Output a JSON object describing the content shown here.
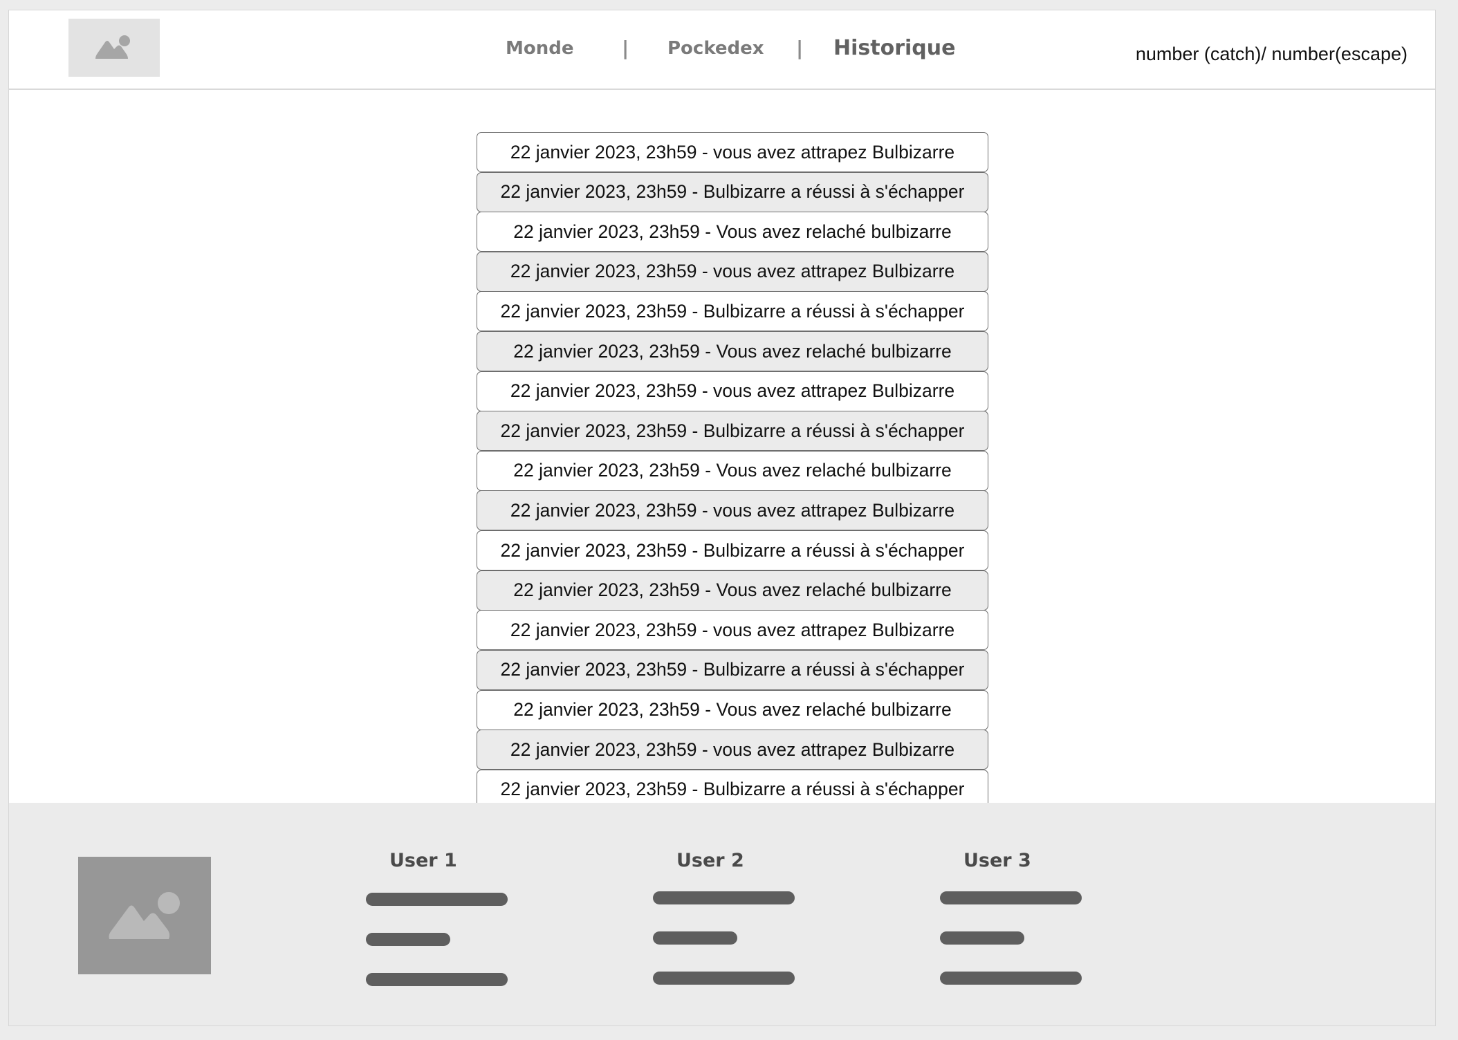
{
  "header": {
    "logo_icon": "image-icon",
    "nav": [
      {
        "label": "Monde",
        "active": false
      },
      {
        "label": "Pockedex",
        "active": false
      },
      {
        "label": "Historique",
        "active": true
      }
    ],
    "separator": "|",
    "counter": "number (catch)/ number(escape)"
  },
  "history": [
    "22 janvier 2023, 23h59 - vous avez attrapez Bulbizarre",
    "22 janvier 2023, 23h59 - Bulbizarre a réussi à s'échapper",
    "22 janvier 2023, 23h59 - Vous avez relaché bulbizarre",
    "22 janvier 2023, 23h59 - vous avez attrapez Bulbizarre",
    "22 janvier 2023, 23h59 - Bulbizarre a réussi à s'échapper",
    "22 janvier 2023, 23h59 - Vous avez relaché bulbizarre",
    "22 janvier 2023, 23h59 - vous avez attrapez Bulbizarre",
    "22 janvier 2023, 23h59 - Bulbizarre a réussi à s'échapper",
    "22 janvier 2023, 23h59 - Vous avez relaché bulbizarre",
    "22 janvier 2023, 23h59 - vous avez attrapez Bulbizarre",
    "22 janvier 2023, 23h59 - Bulbizarre a réussi à s'échapper",
    "22 janvier 2023, 23h59 - Vous avez relaché bulbizarre",
    "22 janvier 2023, 23h59 - vous avez attrapez Bulbizarre",
    "22 janvier 2023, 23h59 - Bulbizarre a réussi à s'échapper",
    "22 janvier 2023, 23h59 - Vous avez relaché bulbizarre",
    "22 janvier 2023, 23h59 - vous avez attrapez Bulbizarre",
    "22 janvier 2023, 23h59 - Bulbizarre a réussi à s'échapper"
  ],
  "footer": {
    "image_icon": "image-icon",
    "users": [
      {
        "name": "User 1"
      },
      {
        "name": "User 2"
      },
      {
        "name": "User 3"
      }
    ]
  }
}
